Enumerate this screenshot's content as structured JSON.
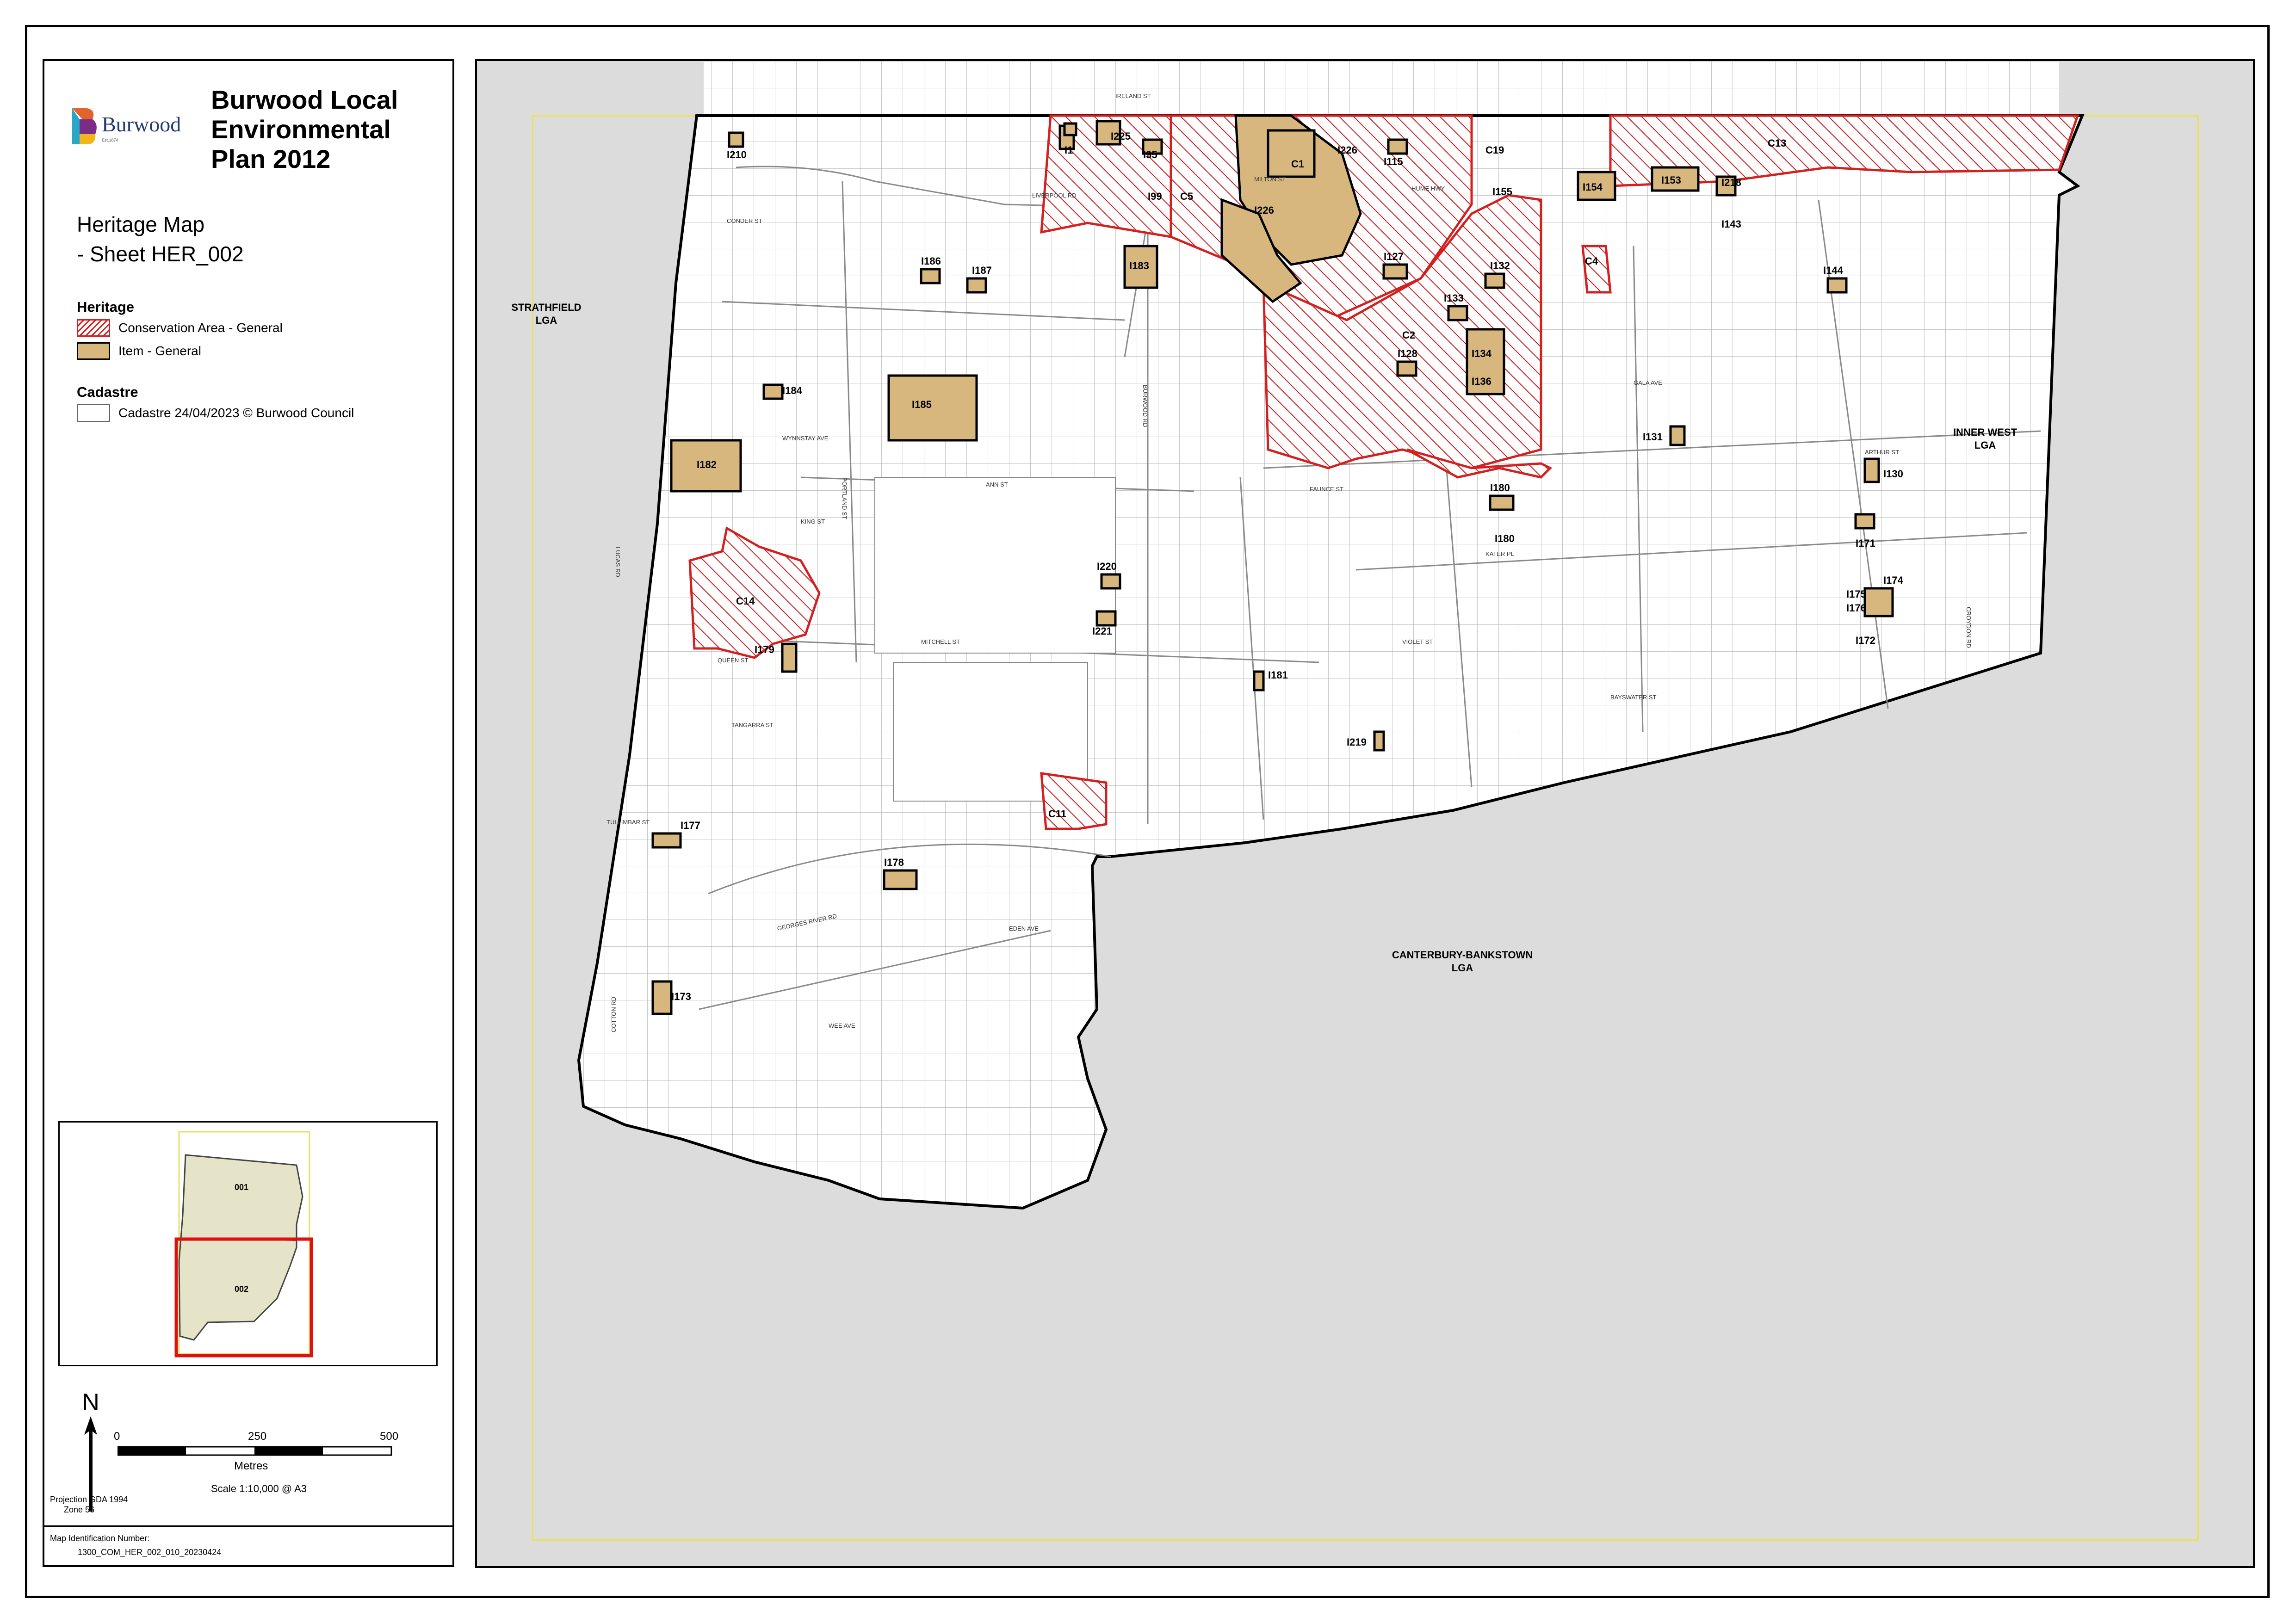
{
  "legend": {
    "logo_text": "Burwood",
    "logo_sub": "Est.1874",
    "title_lines": [
      "Burwood Local",
      "Environmental",
      "Plan 2012"
    ],
    "map_name_line1": "Heritage Map",
    "map_name_line2": "- Sheet HER_002",
    "heritage_heading": "Heritage",
    "conservation_label": "Conservation Area - General",
    "item_label": "Item - General",
    "cadastre_heading": "Cadastre",
    "cadastre_label": "Cadastre 24/04/2023 © Burwood Council"
  },
  "inset": {
    "sheet_top": "001",
    "sheet_bottom": "002"
  },
  "north_arrow": {
    "letter": "N"
  },
  "scale_bar": {
    "tick0": "0",
    "tick1": "250",
    "tick2": "500",
    "unit": "Metres",
    "scale_text": "Scale 1:10,000 @ A3"
  },
  "projection": {
    "line1": "Projection GDA 1994",
    "line2": "Zone 56"
  },
  "map_id": {
    "label": "Map Identification Number:",
    "value": "1300_COM_HER_002_010_20230424"
  },
  "colors": {
    "conservation": "#d32020",
    "item_fill": "#d8b77f",
    "outside": "#dcdcdc",
    "sheet_extent": "#e8e06a"
  },
  "lga_labels": {
    "strathfield": [
      "STRATHFIELD",
      "LGA"
    ],
    "inner_west": [
      "INNER WEST",
      "LGA"
    ],
    "canterbury": [
      "CANTERBURY-BANKSTOWN",
      "LGA"
    ]
  },
  "conservation_areas": [
    "C1",
    "C2",
    "C4",
    "C5",
    "C11",
    "C13",
    "C14",
    "C19"
  ],
  "items": [
    "I1",
    "I35",
    "I99",
    "I115",
    "I127",
    "I128",
    "I130",
    "I131",
    "I132",
    "I133",
    "I134",
    "I136",
    "I143",
    "I144",
    "I153",
    "I154",
    "I155",
    "I171",
    "I172",
    "I173",
    "I174",
    "I175",
    "I176",
    "I177",
    "I178",
    "I179",
    "I180",
    "I180",
    "I181",
    "I182",
    "I183",
    "I184",
    "I185",
    "I186",
    "I187",
    "I210",
    "I218",
    "I219",
    "I220",
    "I221",
    "I225",
    "I226",
    "I226"
  ],
  "streets": [
    "LIVERPOOL RD",
    "HUME HWY",
    "GEORGES RIVER RD",
    "BURWOOD RD",
    "PORTLAND ST",
    "MITCHELL ST",
    "ANN ST",
    "FAUNCE ST",
    "KING ST",
    "QUEEN ST",
    "TANGARRA ST",
    "TULLIMBAR ST",
    "WYNNSTAY AVE",
    "CROYDON RD",
    "LUCAS RD",
    "VIOLET ST",
    "BAYSWATER ST",
    "KATER PL",
    "ARTHUR ST",
    "MILTON ST",
    "CONDER ST",
    "COTTON RD",
    "IRELAND ST",
    "WEE AVE",
    "EDEN AVE",
    "GALA AVE"
  ]
}
